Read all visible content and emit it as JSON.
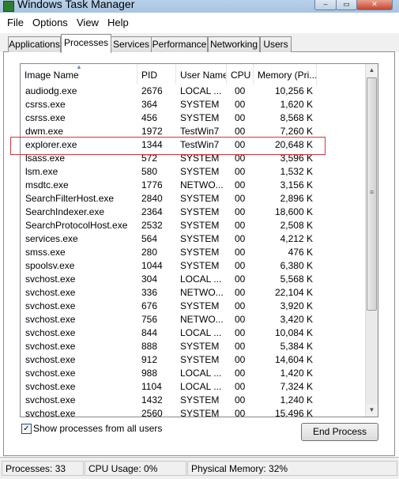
{
  "window": {
    "title": "Windows Task Manager",
    "minimize_glyph": "–",
    "maximize_glyph": "▭",
    "close_glyph": "✕"
  },
  "menu": [
    "File",
    "Options",
    "View",
    "Help"
  ],
  "tabs": [
    "Applications",
    "Processes",
    "Services",
    "Performance",
    "Networking",
    "Users"
  ],
  "active_tab": "Processes",
  "table": {
    "columns": [
      "Image Name",
      "PID",
      "User Name",
      "CPU",
      "Memory (Pri..."
    ],
    "sort_indicator": "▲",
    "rows": [
      [
        "audiodg.exe",
        "2676",
        "LOCAL ...",
        "00",
        "10,256 K"
      ],
      [
        "csrss.exe",
        "364",
        "SYSTEM",
        "00",
        "1,620 K"
      ],
      [
        "csrss.exe",
        "456",
        "SYSTEM",
        "00",
        "8,568 K"
      ],
      [
        "dwm.exe",
        "1972",
        "TestWin7",
        "00",
        "7,260 K"
      ],
      [
        "explorer.exe",
        "1344",
        "TestWin7",
        "00",
        "20,648 K"
      ],
      [
        "lsass.exe",
        "572",
        "SYSTEM",
        "00",
        "3,596 K"
      ],
      [
        "lsm.exe",
        "580",
        "SYSTEM",
        "00",
        "1,532 K"
      ],
      [
        "msdtc.exe",
        "1776",
        "NETWO...",
        "00",
        "3,156 K"
      ],
      [
        "SearchFilterHost.exe",
        "2840",
        "SYSTEM",
        "00",
        "2,896 K"
      ],
      [
        "SearchIndexer.exe",
        "2364",
        "SYSTEM",
        "00",
        "18,600 K"
      ],
      [
        "SearchProtocolHost.exe",
        "2532",
        "SYSTEM",
        "00",
        "2,508 K"
      ],
      [
        "services.exe",
        "564",
        "SYSTEM",
        "00",
        "4,212 K"
      ],
      [
        "smss.exe",
        "280",
        "SYSTEM",
        "00",
        "476 K"
      ],
      [
        "spoolsv.exe",
        "1044",
        "SYSTEM",
        "00",
        "6,380 K"
      ],
      [
        "svchost.exe",
        "304",
        "LOCAL ...",
        "00",
        "5,568 K"
      ],
      [
        "svchost.exe",
        "336",
        "NETWO...",
        "00",
        "22,104 K"
      ],
      [
        "svchost.exe",
        "676",
        "SYSTEM",
        "00",
        "3,920 K"
      ],
      [
        "svchost.exe",
        "756",
        "NETWO...",
        "00",
        "3,420 K"
      ],
      [
        "svchost.exe",
        "844",
        "LOCAL ...",
        "00",
        "10,084 K"
      ],
      [
        "svchost.exe",
        "888",
        "SYSTEM",
        "00",
        "5,384 K"
      ],
      [
        "svchost.exe",
        "912",
        "SYSTEM",
        "00",
        "14,604 K"
      ],
      [
        "svchost.exe",
        "988",
        "LOCAL ...",
        "00",
        "1,420 K"
      ],
      [
        "svchost.exe",
        "1104",
        "LOCAL ...",
        "00",
        "7,324 K"
      ],
      [
        "svchost.exe",
        "1432",
        "SYSTEM",
        "00",
        "1,240 K"
      ],
      [
        "svchost.exe",
        "2560",
        "SYSTEM",
        "00",
        "15,496 K"
      ]
    ],
    "highlighted_process": "explorer.exe"
  },
  "scrollbar": {
    "up_glyph": "▲",
    "down_glyph": "▼",
    "grip_glyph": "≡"
  },
  "show_all_users": {
    "label": "Show processes from all users",
    "checked": true,
    "check_glyph": "✓"
  },
  "end_process_label": "End Process",
  "status": {
    "processes": "Processes: 33",
    "cpu": "CPU Usage: 0%",
    "memory": "Physical Memory: 32%"
  },
  "colors": {
    "highlight_border": "#d9333f",
    "title_bar": "#b9d1ea"
  }
}
